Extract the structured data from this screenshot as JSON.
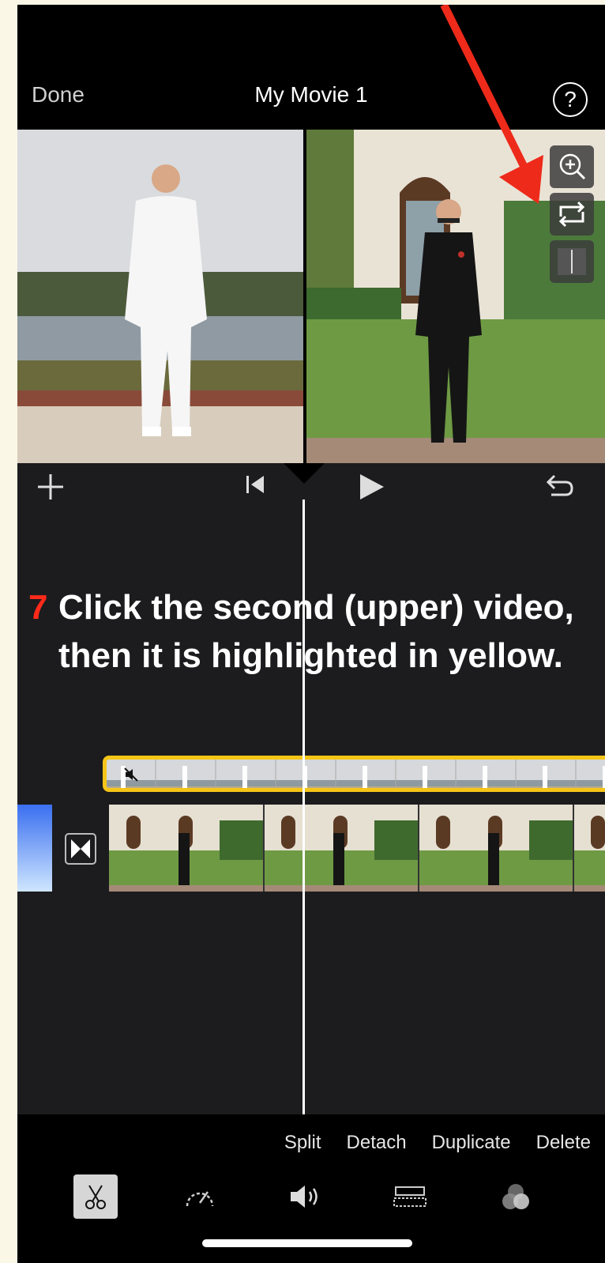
{
  "nav": {
    "done": "Done",
    "title": "My Movie 1",
    "help": "?"
  },
  "instruction": {
    "number": "7",
    "line1": "Click the second (upper) video,",
    "line2": "then it is highlighted in yellow."
  },
  "actions": {
    "split": "Split",
    "detach": "Detach",
    "duplicate": "Duplicate",
    "delete": "Delete"
  },
  "colors": {
    "highlight": "#f5c518",
    "arrow": "#ee2a1a",
    "step_number": "#ff2a1a"
  },
  "icons": [
    "plus-icon",
    "skip-back-icon",
    "play-icon",
    "undo-icon",
    "zoom-in-icon",
    "swap-icon",
    "split-screen-icon",
    "scissors-icon",
    "speed-icon",
    "volume-icon",
    "titles-icon",
    "filters-icon",
    "mute-icon",
    "transition-icon"
  ]
}
